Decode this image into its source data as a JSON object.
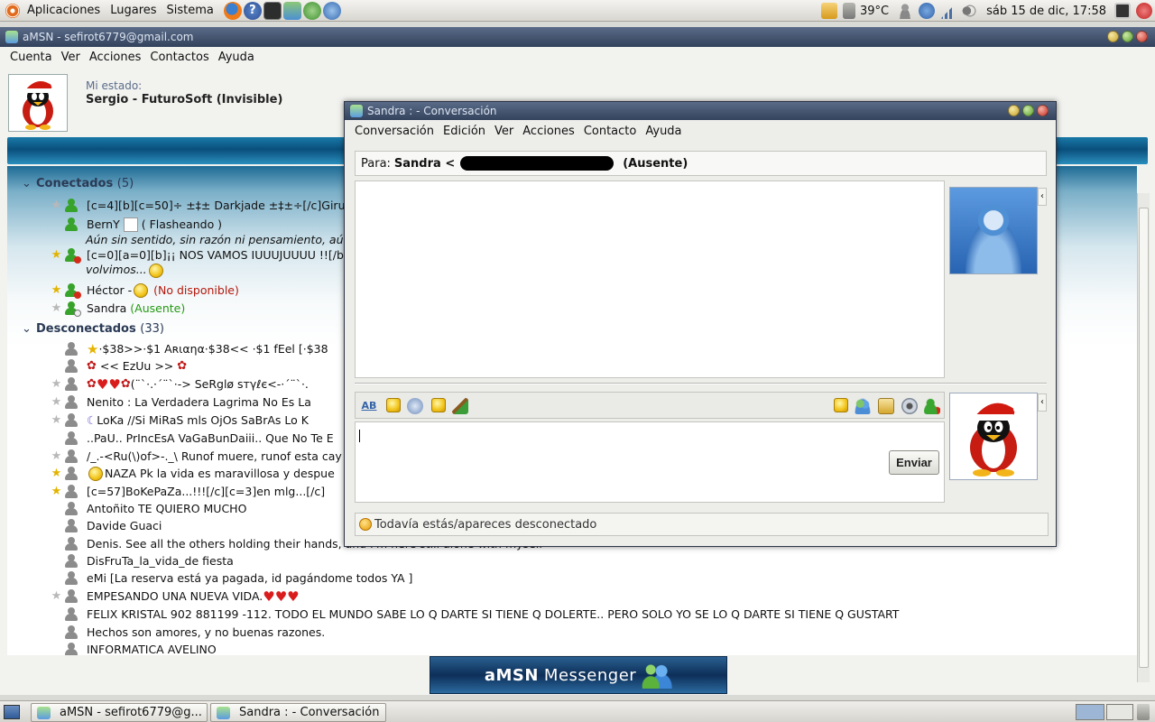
{
  "top_panel": {
    "menus": [
      "Aplicaciones",
      "Lugares",
      "Sistema"
    ],
    "temperature": "39°C",
    "clock": "sáb 15 de dic, 17:58"
  },
  "main_window": {
    "title": "aMSN - sefirot6779@gmail.com",
    "menu": [
      "Cuenta",
      "Ver",
      "Acciones",
      "Contactos",
      "Ayuda"
    ],
    "my_state_label": "Mi estado:",
    "my_state_value": "Sergio - FuturoSoft (Invisible)",
    "groups": {
      "online": {
        "name": "Conectados",
        "count": "(5)"
      },
      "offline": {
        "name": "Desconectados",
        "count": "(33)"
      }
    },
    "online_contacts": [
      {
        "text": "[c=4][b][c=50]÷ ±‡± Darkjade ±‡±÷[/c]Giru"
      },
      {
        "text": "BernY",
        "status": "( Flasheando )",
        "message": "Aún sin sentido, sin razón ni pensamiento, aún"
      },
      {
        "text": "[c=0][a=0][b]¡¡ NOS VAMOS IUUUJUUUU !![/b]",
        "message": "volvimos..."
      },
      {
        "text": "Héctor -",
        "status": "(No disponible)"
      },
      {
        "text": "Sandra",
        "status": "(Ausente)"
      }
    ],
    "offline_contacts": [
      {
        "text": "·$38>>·$1 Aʀιαηα·$38<<  ·$1 fEel [·$38"
      },
      {
        "text": "<< EzUu >>"
      },
      {
        "text": "(¨`·.·´¨`·-> SeRglø ѕтγℓє<-·´¨`·."
      },
      {
        "text": "Nenito : La Verdadera Lagrima No Es La"
      },
      {
        "text": "LoKa //Si MiRaS mls OjOs SaBrAs Lo K"
      },
      {
        "text": "..PaU..  PrIncEsA VaGaBunDaiii..  Que No Te E"
      },
      {
        "text": "/_.-<Ru(\\)of>-._\\  Runof muere, runof esta cay"
      },
      {
        "text": "NAZA Pk la vida es maravillosa y despue"
      },
      {
        "text": "[c=57]BoKePaZa...!!![/c][c=3]en mlg...[/c]"
      },
      {
        "text": "Antoñito TE QUIERO MUCHO"
      },
      {
        "text": "Davide  Guaci"
      },
      {
        "text": "Denis. See all the others holding their hands, and i'm here still alone with myself"
      },
      {
        "text": "DisFruTa_la_vida_de fiesta"
      },
      {
        "text": "eMi [La reserva está ya pagada, id pagándome todos YA  ]"
      },
      {
        "text": "EMPESANDO UNA NUEVA VIDA."
      },
      {
        "text": "FELIX KRISTAL 902 881199 -112. TODO EL MUNDO SABE LO Q DARTE SI TIENE Q DOLERTE.. PERO SOLO YO SE LO Q DARTE SI TIENE Q GUSTART"
      },
      {
        "text": "Hechos son amores, y no buenas razones."
      },
      {
        "text": "INFORMATICA AVELINO"
      }
    ],
    "banner_left": "aMSN",
    "banner_right": "Messenger"
  },
  "conversation": {
    "title": "Sandra :  - Conversación",
    "menu": [
      "Conversación",
      "Edición",
      "Ver",
      "Acciones",
      "Contacto",
      "Ayuda"
    ],
    "to_label": "Para:",
    "to_name": "Sandra <",
    "to_status": "(Ausente)",
    "send_label": "Enviar",
    "status_text": "Todavía estás/apareces desconectado"
  },
  "taskbar": {
    "tasks": [
      "aMSN - sefirot6779@g...",
      "Sandra :  - Conversación"
    ]
  }
}
